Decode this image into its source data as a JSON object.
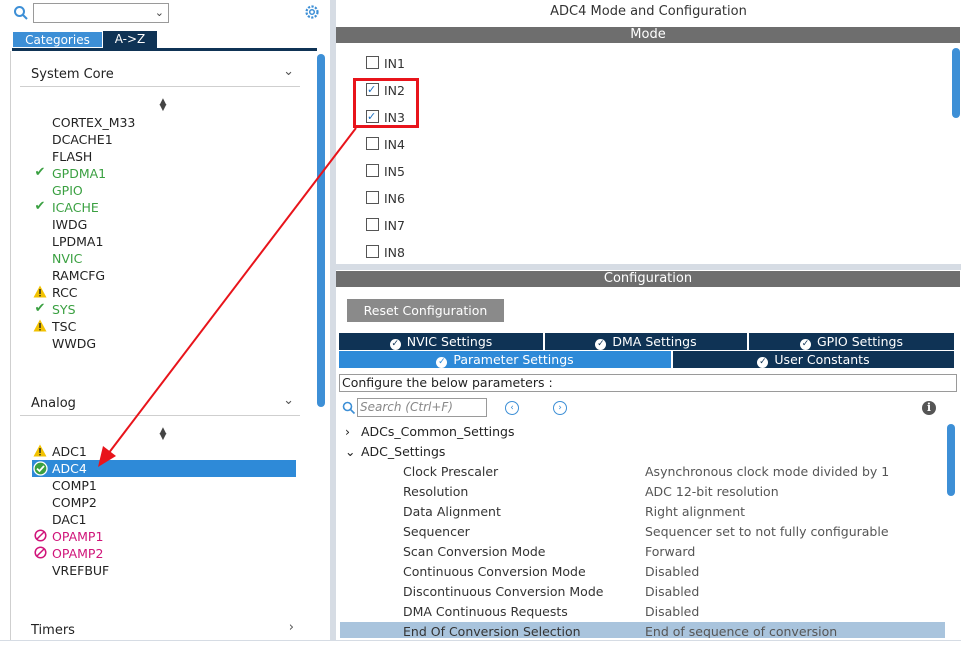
{
  "left": {
    "tabs": [
      "Categories",
      "A->Z"
    ],
    "sections": [
      {
        "title": "System Core",
        "items": [
          {
            "label": "CORTEX_M33",
            "status": "none"
          },
          {
            "label": "DCACHE1",
            "status": "none"
          },
          {
            "label": "FLASH",
            "status": "none"
          },
          {
            "label": "GPDMA1",
            "status": "ok"
          },
          {
            "label": "GPIO",
            "status": "green"
          },
          {
            "label": "ICACHE",
            "status": "ok"
          },
          {
            "label": "IWDG",
            "status": "none"
          },
          {
            "label": "LPDMA1",
            "status": "none"
          },
          {
            "label": "NVIC",
            "status": "green"
          },
          {
            "label": "RAMCFG",
            "status": "none"
          },
          {
            "label": "RCC",
            "status": "warn"
          },
          {
            "label": "SYS",
            "status": "ok"
          },
          {
            "label": "TSC",
            "status": "warn"
          },
          {
            "label": "WWDG",
            "status": "none"
          }
        ]
      },
      {
        "title": "Analog",
        "items": [
          {
            "label": "ADC1",
            "status": "warn"
          },
          {
            "label": "ADC4",
            "status": "selected"
          },
          {
            "label": "COMP1",
            "status": "none"
          },
          {
            "label": "COMP2",
            "status": "none"
          },
          {
            "label": "DAC1",
            "status": "none"
          },
          {
            "label": "OPAMP1",
            "status": "blocked"
          },
          {
            "label": "OPAMP2",
            "status": "blocked"
          },
          {
            "label": "VREFBUF",
            "status": "none"
          }
        ]
      },
      {
        "title": "Timers",
        "items": []
      }
    ]
  },
  "right": {
    "title": "ADC4 Mode and Configuration",
    "mode_bar": "Mode",
    "mode_inputs": [
      {
        "label": "IN1",
        "checked": false
      },
      {
        "label": "IN2",
        "checked": true
      },
      {
        "label": "IN3",
        "checked": true
      },
      {
        "label": "IN4",
        "checked": false
      },
      {
        "label": "IN5",
        "checked": false
      },
      {
        "label": "IN6",
        "checked": false
      },
      {
        "label": "IN7",
        "checked": false
      },
      {
        "label": "IN8",
        "checked": false
      }
    ],
    "config_bar": "Configuration",
    "reset_button": "Reset Configuration",
    "settings_tabs_row1": [
      "NVIC Settings",
      "DMA Settings",
      "GPIO Settings"
    ],
    "settings_tabs_row2": [
      "Parameter Settings",
      "User Constants"
    ],
    "configure_text": "Configure the below parameters :",
    "search_placeholder": "Search (Ctrl+F)",
    "tree": {
      "common": "ADCs_Common_Settings",
      "adc": "ADC_Settings"
    },
    "params": [
      {
        "k": "Clock Prescaler",
        "v": "Asynchronous clock mode divided by 1"
      },
      {
        "k": "Resolution",
        "v": "ADC 12-bit resolution"
      },
      {
        "k": "Data Alignment",
        "v": "Right alignment"
      },
      {
        "k": "Sequencer",
        "v": "Sequencer set to not fully configurable"
      },
      {
        "k": "Scan Conversion Mode",
        "v": "Forward"
      },
      {
        "k": "Continuous Conversion Mode",
        "v": "Disabled"
      },
      {
        "k": "Discontinuous Conversion Mode",
        "v": "Disabled"
      },
      {
        "k": "DMA Continuous Requests",
        "v": "Disabled"
      },
      {
        "k": "End Of Conversion Selection",
        "v": "End of sequence of conversion"
      }
    ]
  },
  "colors": {
    "accent": "#2e8ad8",
    "dark_tab": "#0f3355",
    "annotation": "#e8141b",
    "ok": "#3aa041",
    "warn": "#e3b800",
    "blocked": "#d0147a"
  }
}
